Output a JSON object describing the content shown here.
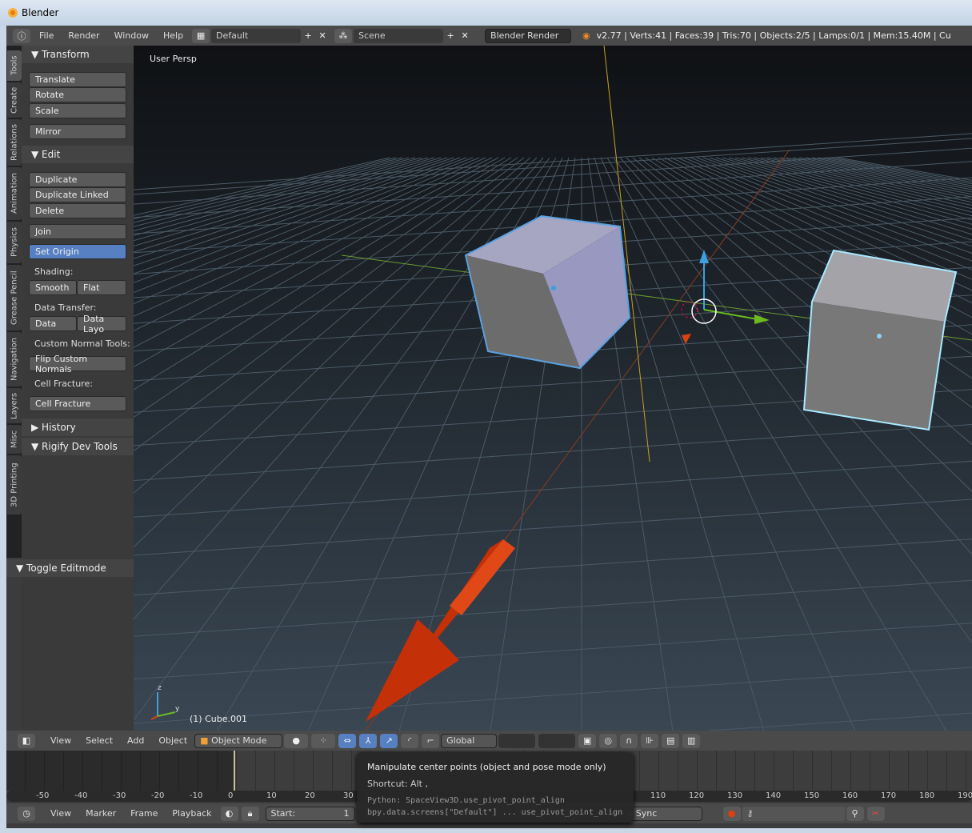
{
  "window": {
    "title": "Blender"
  },
  "topbar": {
    "menus": [
      "File",
      "Render",
      "Window",
      "Help"
    ],
    "layout": "Default",
    "scene": "Scene",
    "engine": "Blender Render",
    "stats": "v2.77 | Verts:41 | Faces:39 | Tris:70 | Objects:2/5 | Lamps:0/1 | Mem:15.40M | Cu"
  },
  "tabs": [
    "Tools",
    "Create",
    "Relations",
    "Animation",
    "Physics",
    "Grease Pencil",
    "Navigation",
    "Layers",
    "Misc",
    "3D Printing"
  ],
  "panel": {
    "transform": "Transform",
    "translate": "Translate",
    "rotate": "Rotate",
    "scale": "Scale",
    "mirror": "Mirror",
    "edit": "Edit",
    "duplicate": "Duplicate",
    "duplicate_linked": "Duplicate Linked",
    "delete": "Delete",
    "join": "Join",
    "set_origin": "Set Origin",
    "shading": "Shading:",
    "smooth": "Smooth",
    "flat": "Flat",
    "data_transfer": "Data Transfer:",
    "data": "Data",
    "data_layo": "Data Layo",
    "custom_normal": "Custom Normal Tools:",
    "flip_normals": "Flip Custom Normals",
    "cell_fracture_label": "Cell Fracture:",
    "cell_fracture": "Cell Fracture",
    "history": "History",
    "rigify": "Rigify Dev Tools",
    "toggle_editmode": "Toggle Editmode"
  },
  "viewport": {
    "view_label": "User Persp",
    "object_label": "(1) Cube.001",
    "axis_z": "z",
    "axis_y": "y"
  },
  "view_toolbar": {
    "menus": [
      "View",
      "Select",
      "Add",
      "Object"
    ],
    "mode": "Object Mode",
    "orientation": "Global"
  },
  "ruler": [
    "-50",
    "-40",
    "-30",
    "-20",
    "-10",
    "0",
    "10",
    "20",
    "30",
    "110",
    "120",
    "130",
    "140",
    "150",
    "160",
    "170",
    "180",
    "190"
  ],
  "timeline_bar": {
    "menus": [
      "View",
      "Marker",
      "Frame",
      "Playback"
    ],
    "start_label": "Start:",
    "start_value": "1",
    "sync": "o Sync"
  },
  "tooltip": {
    "title": "Manipulate center points (object and pose mode only)",
    "shortcut": "Shortcut: Alt ,",
    "python1": "Python: SpaceView3D.use_pivot_point_align",
    "python2": "bpy.data.screens[\"Default\"] ... use_pivot_point_align"
  },
  "colors": {
    "selection": "#5aa0e0",
    "active_outline": "#a8e8ff",
    "arrow": "#d83a10"
  }
}
